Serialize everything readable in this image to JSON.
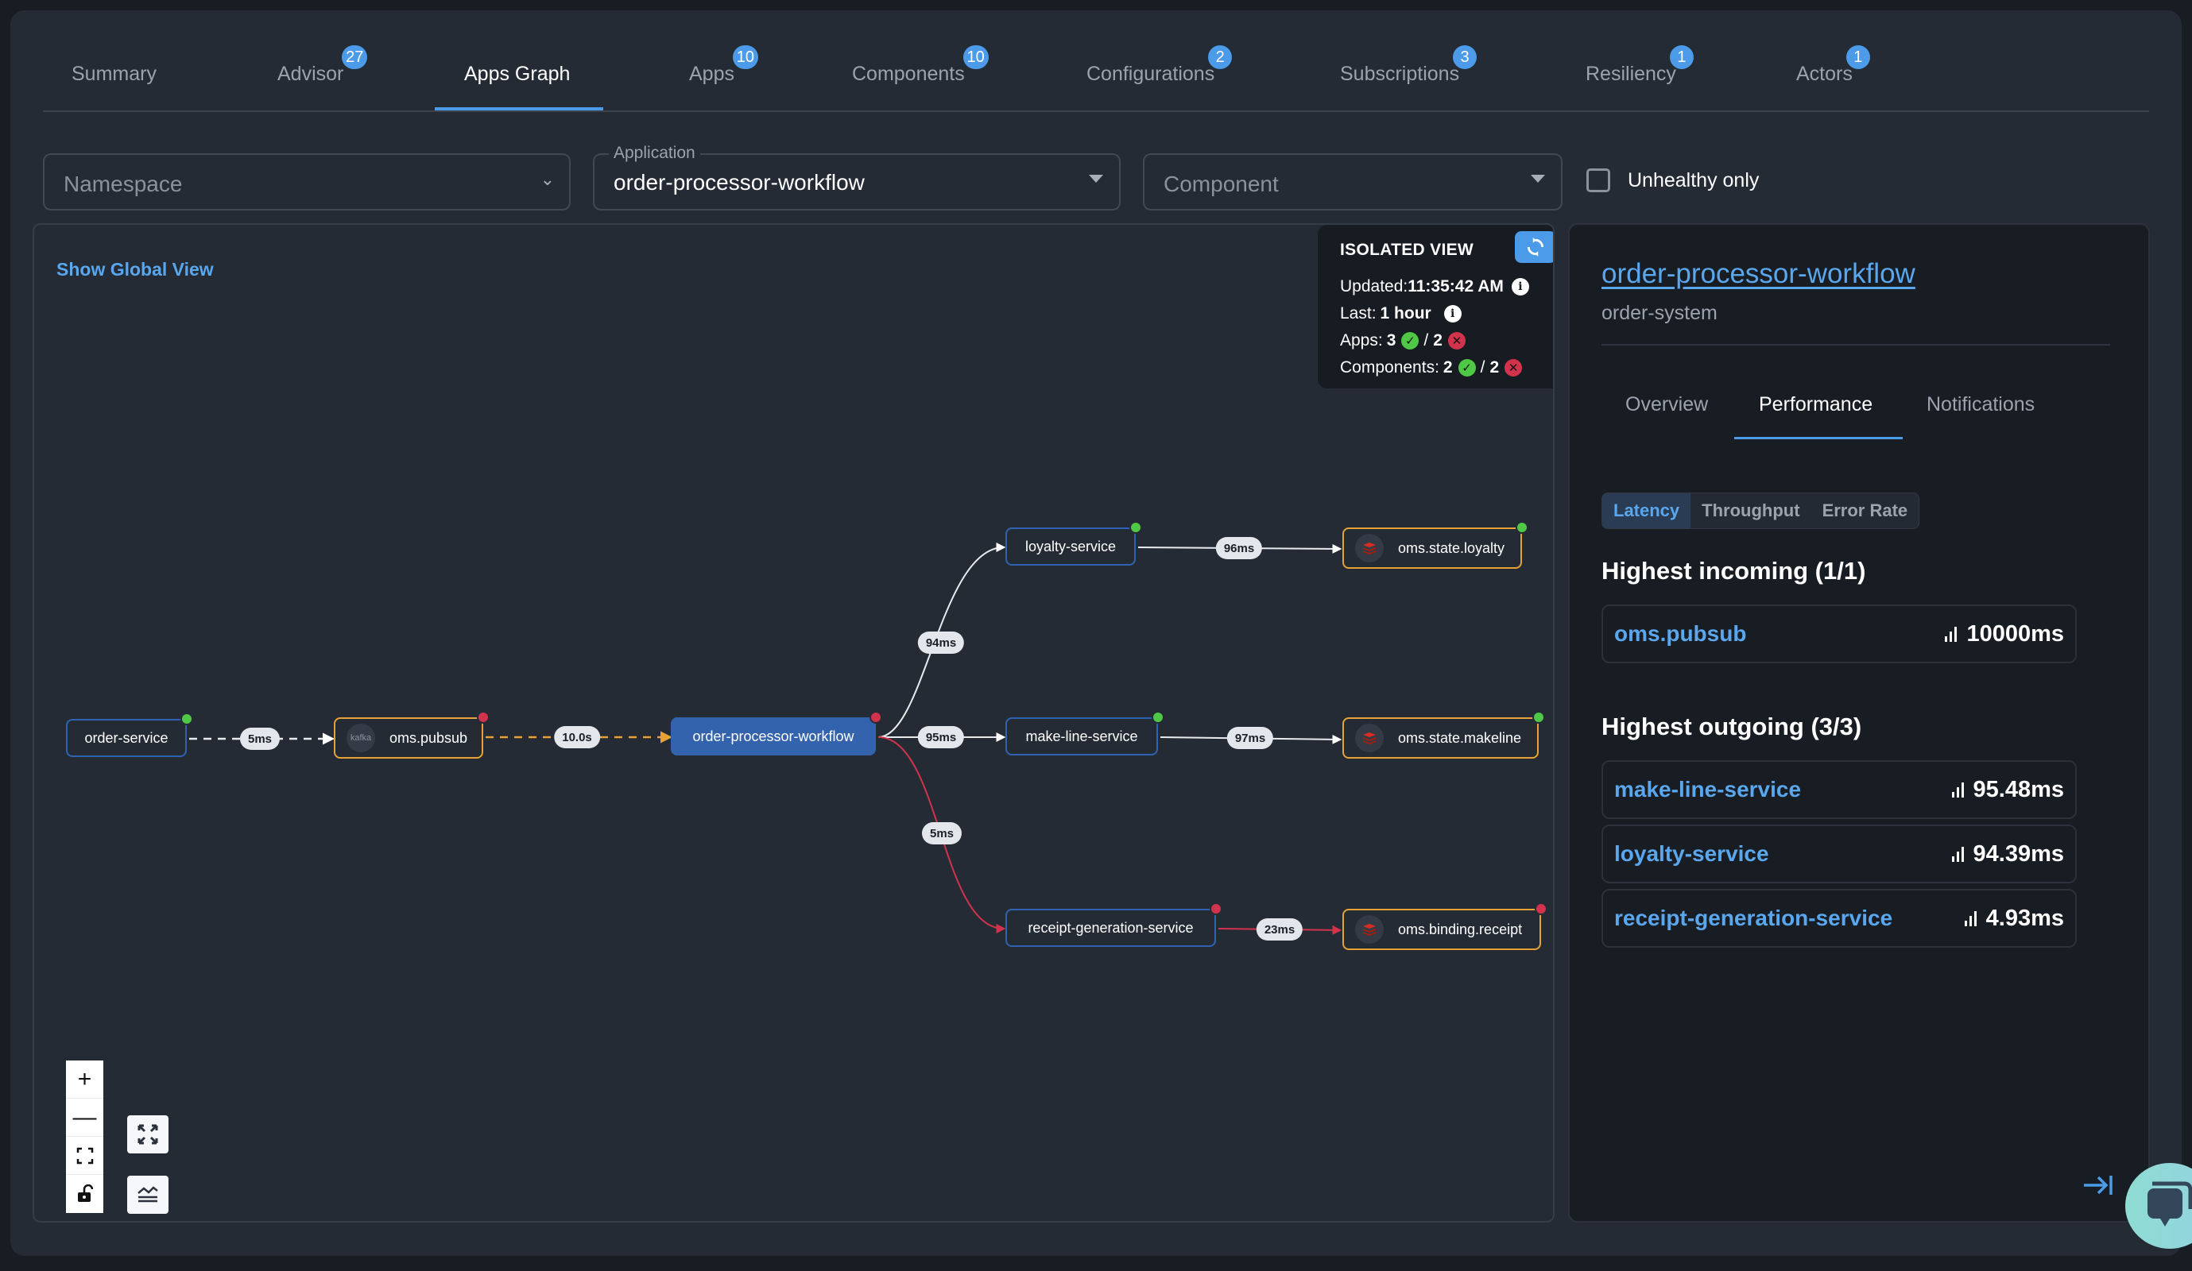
{
  "tabs": [
    {
      "label": "Summary",
      "badge": null,
      "active": false
    },
    {
      "label": "Advisor",
      "badge": "27",
      "active": false
    },
    {
      "label": "Apps Graph",
      "badge": null,
      "active": true
    },
    {
      "label": "Apps",
      "badge": "10",
      "active": false
    },
    {
      "label": "Components",
      "badge": "10",
      "active": false
    },
    {
      "label": "Configurations",
      "badge": "2",
      "active": false
    },
    {
      "label": "Subscriptions",
      "badge": "3",
      "active": false
    },
    {
      "label": "Resiliency",
      "badge": "1",
      "active": false
    },
    {
      "label": "Actors",
      "badge": "1",
      "active": false
    }
  ],
  "filters": {
    "namespace": {
      "placeholder": "Namespace",
      "value": ""
    },
    "application": {
      "label": "Application",
      "value": "order-processor-workflow"
    },
    "component": {
      "placeholder": "Component",
      "value": ""
    },
    "unhealthy_only": {
      "label": "Unhealthy only",
      "checked": false
    }
  },
  "graph": {
    "show_global_view": "Show Global View",
    "isolated_view": {
      "title": "ISOLATED VIEW",
      "updated_label": "Updated:",
      "updated_value": "11:35:42 AM",
      "last_label": "Last:",
      "last_value": "1 hour",
      "apps_label": "Apps:",
      "apps_healthy": "3",
      "apps_unhealthy": "2",
      "components_label": "Components:",
      "components_healthy": "2",
      "components_unhealthy": "2",
      "separator": "/"
    },
    "nodes": [
      {
        "id": "order-service",
        "label": "order-service",
        "kind": "app",
        "status": "healthy"
      },
      {
        "id": "oms.pubsub",
        "label": "oms.pubsub",
        "kind": "component",
        "icon": "kafka",
        "status": "unhealthy"
      },
      {
        "id": "order-processor-workflow",
        "label": "order-processor-workflow",
        "kind": "app",
        "status": "unhealthy",
        "selected": true
      },
      {
        "id": "loyalty-service",
        "label": "loyalty-service",
        "kind": "app",
        "status": "healthy"
      },
      {
        "id": "make-line-service",
        "label": "make-line-service",
        "kind": "app",
        "status": "healthy"
      },
      {
        "id": "receipt-generation-service",
        "label": "receipt-generation-service",
        "kind": "app",
        "status": "unhealthy"
      },
      {
        "id": "oms.state.loyalty",
        "label": "oms.state.loyalty",
        "kind": "component",
        "icon": "redis",
        "status": "healthy"
      },
      {
        "id": "oms.state.makeline",
        "label": "oms.state.makeline",
        "kind": "component",
        "icon": "redis",
        "status": "healthy"
      },
      {
        "id": "oms.binding.receipt",
        "label": "oms.binding.receipt",
        "kind": "component",
        "icon": "redis",
        "status": "unhealthy"
      }
    ],
    "edges": [
      {
        "from": "order-service",
        "to": "oms.pubsub",
        "label": "5ms",
        "style": "dashed-white"
      },
      {
        "from": "oms.pubsub",
        "to": "order-processor-workflow",
        "label": "10.0s",
        "style": "dashed-orange"
      },
      {
        "from": "order-processor-workflow",
        "to": "loyalty-service",
        "label": "94ms",
        "style": "white"
      },
      {
        "from": "order-processor-workflow",
        "to": "make-line-service",
        "label": "95ms",
        "style": "white"
      },
      {
        "from": "order-processor-workflow",
        "to": "receipt-generation-service",
        "label": "5ms",
        "style": "red"
      },
      {
        "from": "loyalty-service",
        "to": "oms.state.loyalty",
        "label": "96ms",
        "style": "white"
      },
      {
        "from": "make-line-service",
        "to": "oms.state.makeline",
        "label": "97ms",
        "style": "white"
      },
      {
        "from": "receipt-generation-service",
        "to": "oms.binding.receipt",
        "label": "23ms",
        "style": "red"
      }
    ],
    "icon_text": {
      "kafka": "kafka"
    }
  },
  "panel": {
    "title": "order-processor-workflow",
    "subtitle": "order-system",
    "tabs": [
      {
        "label": "Overview",
        "active": false
      },
      {
        "label": "Performance",
        "active": true
      },
      {
        "label": "Notifications",
        "active": false
      }
    ],
    "metric_tabs": [
      {
        "label": "Latency",
        "active": true
      },
      {
        "label": "Throughput",
        "active": false
      },
      {
        "label": "Error Rate",
        "active": false
      }
    ],
    "incoming": {
      "heading": "Highest incoming (1/1)",
      "items": [
        {
          "name": "oms.pubsub",
          "value": "10000ms"
        }
      ]
    },
    "outgoing": {
      "heading": "Highest outgoing (3/3)",
      "items": [
        {
          "name": "make-line-service",
          "value": "95.48ms"
        },
        {
          "name": "loyalty-service",
          "value": "94.39ms"
        },
        {
          "name": "receipt-generation-service",
          "value": "4.93ms"
        }
      ]
    }
  },
  "colors": {
    "accent": "#4b9be8",
    "link": "#5aa7ee",
    "healthy": "#4fc845",
    "unhealthy": "#d2334c",
    "component_border": "#e6a235",
    "app_border": "#2f63b3",
    "selected_node": "#3463ad"
  }
}
